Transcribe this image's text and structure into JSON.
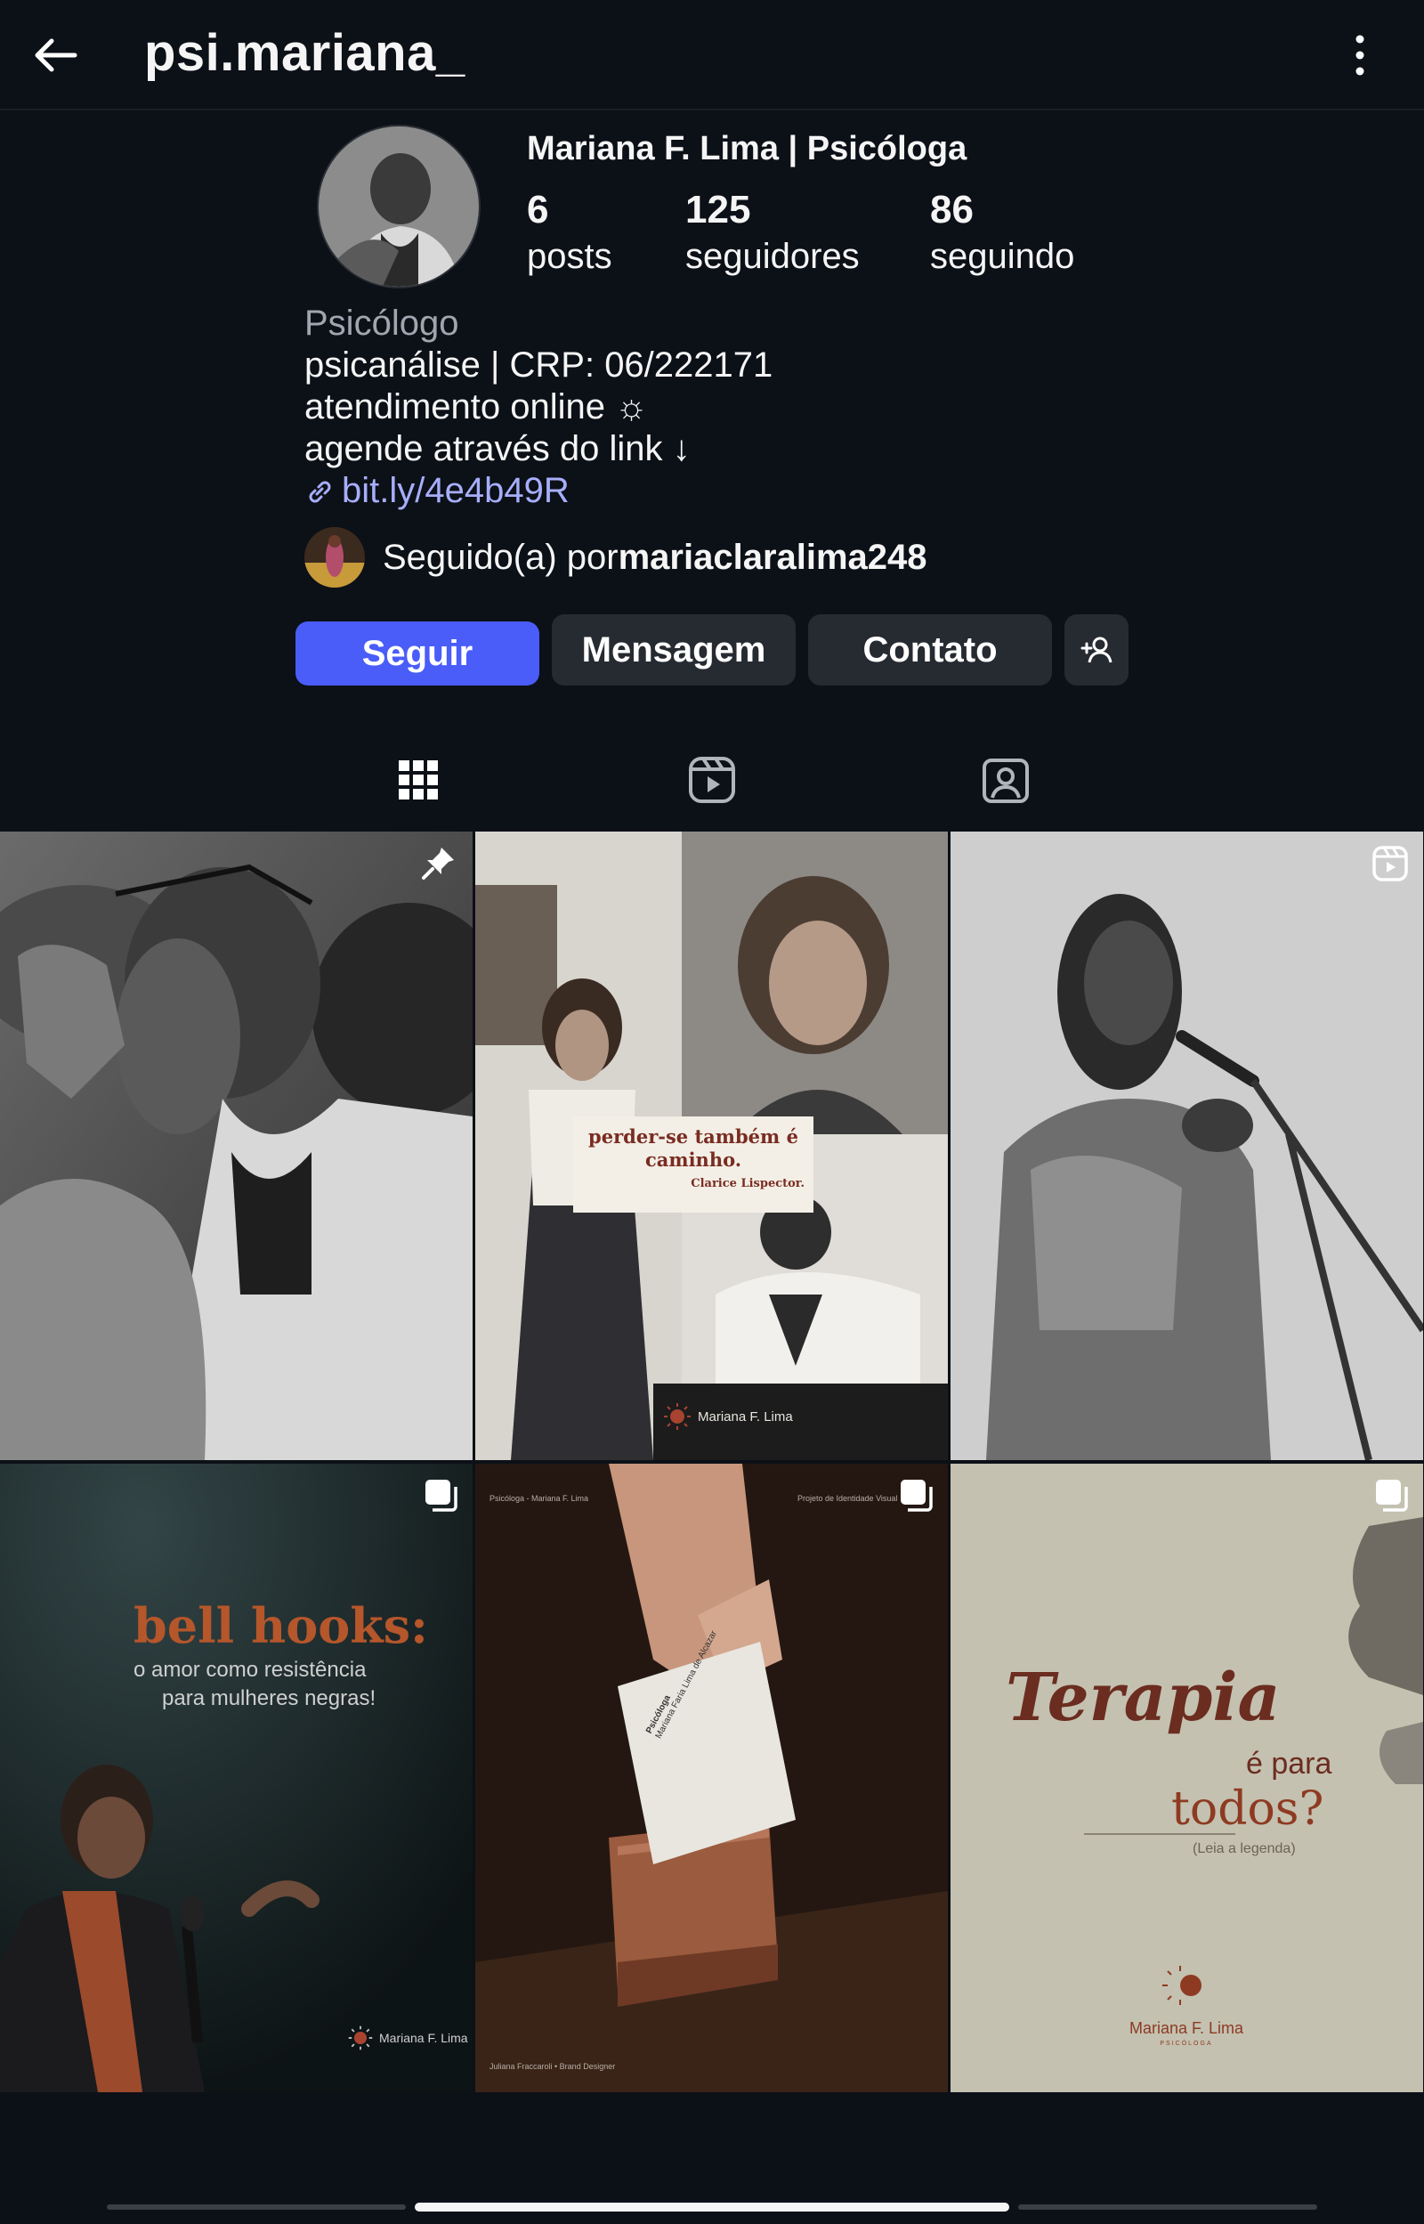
{
  "header": {
    "username": "psi.mariana_"
  },
  "profile": {
    "display_name": "Mariana F. Lima | Psicóloga",
    "stats": [
      {
        "value": "6",
        "label": "posts"
      },
      {
        "value": "125",
        "label": "seguidores"
      },
      {
        "value": "86",
        "label": "seguindo"
      }
    ],
    "category": "Psicólogo",
    "bio_lines": [
      "psicanálise | CRP: 06/222171",
      "atendimento online ☼",
      "agende através do link ↓"
    ],
    "link": "bit.ly/4e4b49R",
    "followed_by_prefix": "Seguido(a) por ",
    "followed_by_user": "mariaclaralima248"
  },
  "actions": {
    "follow": "Seguir",
    "message": "Mensagem",
    "contact": "Contato"
  },
  "tabs": [
    "grid-icon",
    "reels-icon",
    "tagged-icon"
  ],
  "posts": [
    {
      "kind": "photo",
      "badge": "pin-icon"
    },
    {
      "kind": "quote",
      "quote": "perder-se também é caminho.",
      "author": "Clarice Lispector.",
      "brand": "Mariana F. Lima"
    },
    {
      "kind": "reel",
      "badge": "reel-icon"
    },
    {
      "kind": "carousel",
      "badge": "carousel-icon",
      "title": "bell hooks:",
      "subtitle_1": "o amor como resistência",
      "subtitle_2": "para mulheres negras!",
      "brand": "Mariana F. Lima"
    },
    {
      "kind": "carousel",
      "badge": "carousel-icon",
      "top_left": "Psicóloga - Mariana F. Lima",
      "top_right": "Projeto de Identidade Visual",
      "bottom_left": "Juliana Fraccaroli  •  Brand Designer",
      "card_line_1": "Psicóloga",
      "card_line_2": "Mariana Faria Lima de Alcazar"
    },
    {
      "kind": "carousel",
      "badge": "carousel-icon",
      "line_1": "Terapia",
      "line_2": "é para",
      "line_3": "todos?",
      "note": "(Leia a legenda)",
      "brand": "Mariana F. Lima",
      "brand_sub": "PSICÓLOGA"
    }
  ],
  "colors": {
    "accent": "#4a5df9",
    "link": "#a7aefa",
    "background": "#0c1017"
  }
}
